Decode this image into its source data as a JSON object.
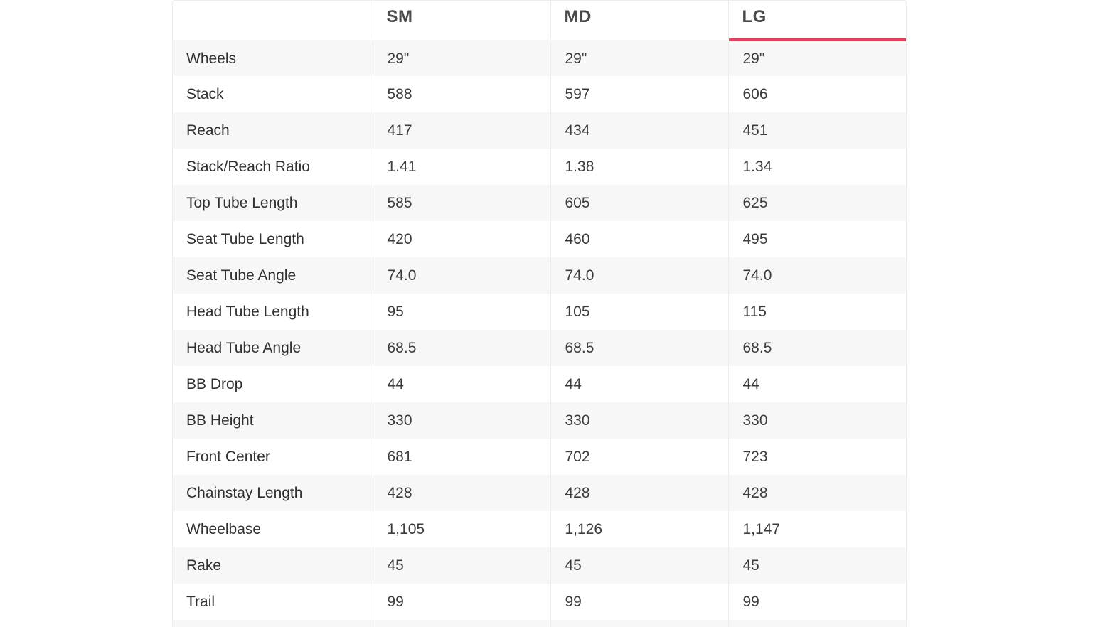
{
  "table": {
    "corner": "",
    "headers": [
      "SM",
      "MD",
      "LG"
    ],
    "active_header": "LG",
    "accent_color": "#e8405c",
    "rows": [
      {
        "label": "Wheels",
        "values": [
          "29\"",
          "29\"",
          "29\""
        ]
      },
      {
        "label": "Stack",
        "values": [
          "588",
          "597",
          "606"
        ]
      },
      {
        "label": "Reach",
        "values": [
          "417",
          "434",
          "451"
        ]
      },
      {
        "label": "Stack/Reach Ratio",
        "values": [
          "1.41",
          "1.38",
          "1.34"
        ]
      },
      {
        "label": "Top Tube Length",
        "values": [
          "585",
          "605",
          "625"
        ]
      },
      {
        "label": "Seat Tube Length",
        "values": [
          "420",
          "460",
          "495"
        ]
      },
      {
        "label": "Seat Tube Angle",
        "values": [
          "74.0",
          "74.0",
          "74.0"
        ]
      },
      {
        "label": "Head Tube Length",
        "values": [
          "95",
          "105",
          "115"
        ]
      },
      {
        "label": "Head Tube Angle",
        "values": [
          "68.5",
          "68.5",
          "68.5"
        ]
      },
      {
        "label": "BB Drop",
        "values": [
          "44",
          "44",
          "44"
        ]
      },
      {
        "label": "BB Height",
        "values": [
          "330",
          "330",
          "330"
        ]
      },
      {
        "label": "Front Center",
        "values": [
          "681",
          "702",
          "723"
        ]
      },
      {
        "label": "Chainstay Length",
        "values": [
          "428",
          "428",
          "428"
        ]
      },
      {
        "label": "Wheelbase",
        "values": [
          "1,105",
          "1,126",
          "1,147"
        ]
      },
      {
        "label": "Rake",
        "values": [
          "45",
          "45",
          "45"
        ]
      },
      {
        "label": "Trail",
        "values": [
          "99",
          "99",
          "99"
        ]
      },
      {
        "label": "",
        "values": [
          "",
          "",
          ""
        ]
      }
    ]
  }
}
